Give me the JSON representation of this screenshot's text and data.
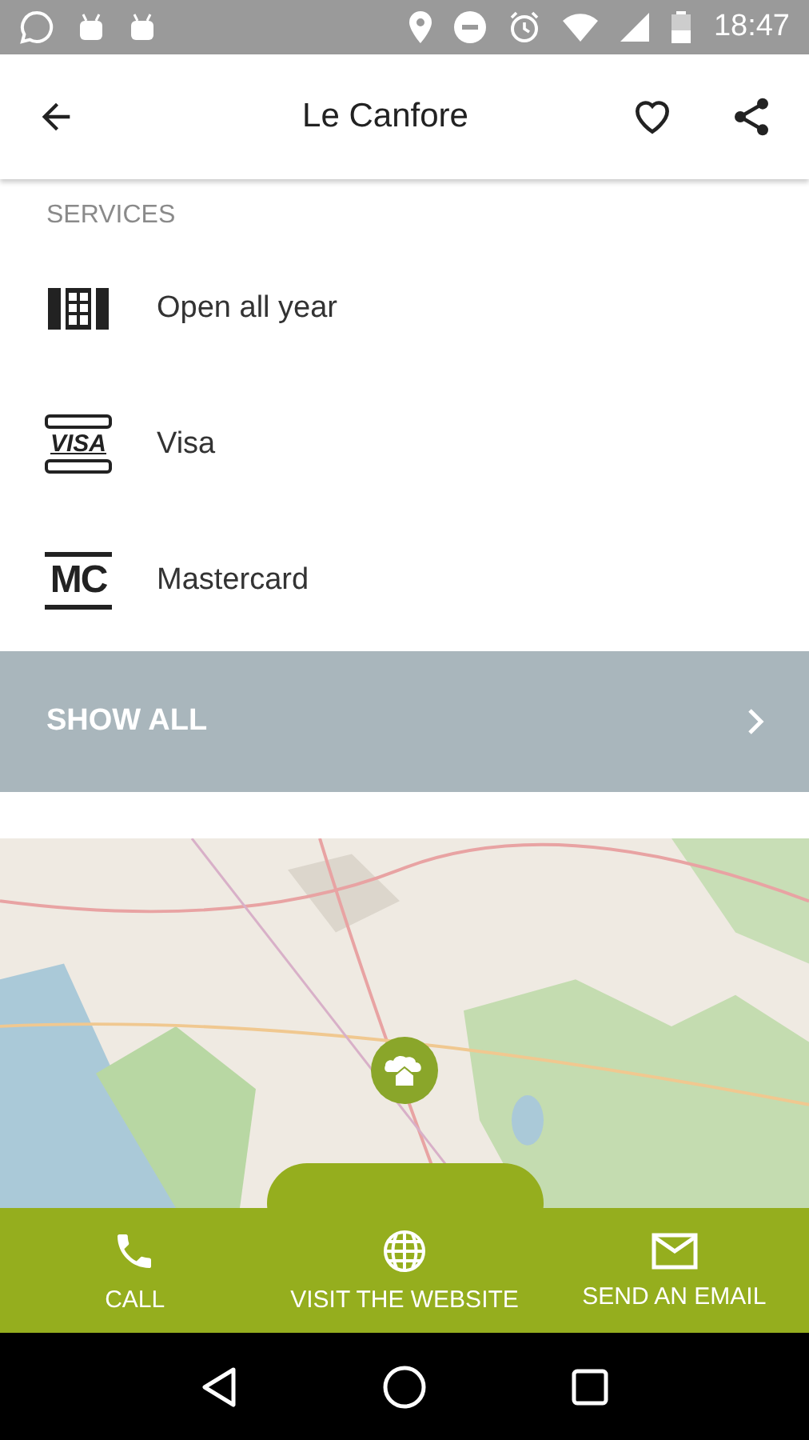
{
  "status_bar": {
    "time": "18:47"
  },
  "app_bar": {
    "title": "Le Canfore"
  },
  "services": {
    "header": "SERVICES",
    "items": [
      {
        "kind": "calendar",
        "label": "Open all year"
      },
      {
        "kind": "visa",
        "icon_text": "VISA",
        "label": "Visa"
      },
      {
        "kind": "mastercard",
        "icon_text": "MC",
        "label": "Mastercard"
      }
    ],
    "show_all": "SHOW ALL"
  },
  "actions": [
    {
      "kind": "phone",
      "label": "CALL"
    },
    {
      "kind": "globe",
      "label": "VISIT THE WEBSITE"
    },
    {
      "kind": "mail",
      "label": "SEND AN EMAIL"
    }
  ]
}
